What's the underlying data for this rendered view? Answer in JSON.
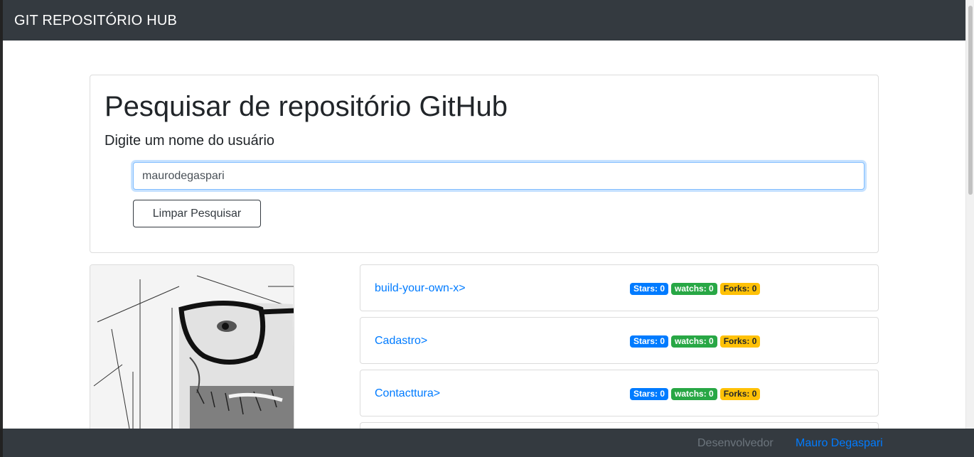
{
  "navbar": {
    "brand": "GIT REPOSITÓRIO HUB"
  },
  "search": {
    "title": "Pesquisar de repositório GitHub",
    "subtitle": "Digite um nome do usuário",
    "input_value": "maurodegaspari",
    "clear_button": "Limpar Pesquisar"
  },
  "repos": [
    {
      "name": "build-your-own-x>",
      "stars": "Stars: 0",
      "watchs": "watchs: 0",
      "forks": "Forks: 0"
    },
    {
      "name": "Cadastro>",
      "stars": "Stars: 0",
      "watchs": "watchs: 0",
      "forks": "Forks: 0"
    },
    {
      "name": "Contacttura>",
      "stars": "Stars: 0",
      "watchs": "watchs: 0",
      "forks": "Forks: 0"
    }
  ],
  "footer": {
    "label": "Desenvolvedor",
    "name": "Mauro Degaspari"
  },
  "colors": {
    "navbar": "#343a40",
    "link": "#007bff",
    "stars_badge": "#007bff",
    "watchs_badge": "#28a745",
    "forks_badge": "#ffc107"
  }
}
